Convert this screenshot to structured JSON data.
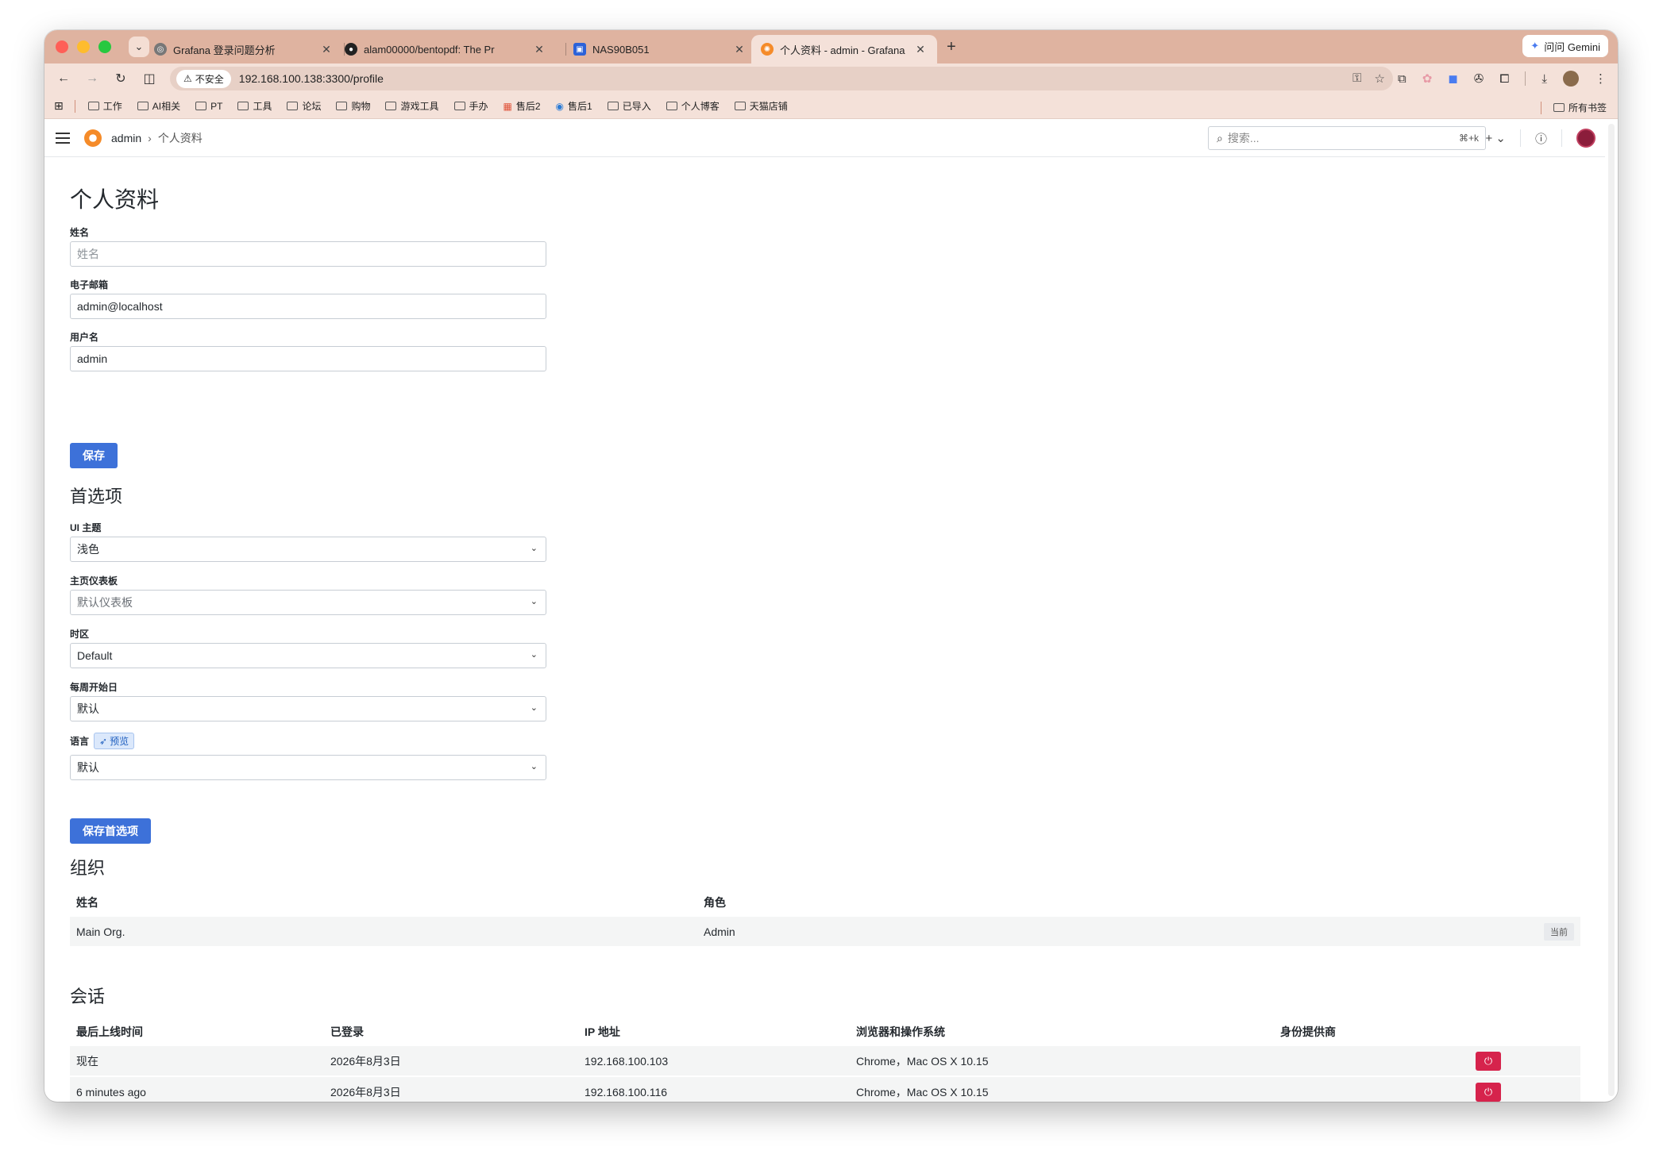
{
  "browser": {
    "tabs": [
      {
        "title": "Grafana 登录问题分析"
      },
      {
        "title": "alam00000/bentopdf: The Pr"
      },
      {
        "title": "NAS90B051"
      },
      {
        "title": "个人资料 - admin - Grafana"
      }
    ],
    "gemini_label": "问问 Gemini",
    "security_label": "不安全",
    "url": "192.168.100.138:3300/profile",
    "bookmarks": [
      "工作",
      "AI相关",
      "PT",
      "工具",
      "论坛",
      "购物",
      "游戏工具",
      "手办",
      "售后2",
      "售后1",
      "已导入",
      "个人博客",
      "天猫店铺"
    ],
    "all_bookmarks": "所有书签"
  },
  "header": {
    "breadcrumb_root": "admin",
    "breadcrumb_current": "个人资料",
    "search_placeholder": "搜索...",
    "search_shortcut": "⌘+k"
  },
  "profile": {
    "title": "个人资料",
    "name_label": "姓名",
    "name_placeholder": "姓名",
    "email_label": "电子邮箱",
    "email_value": "admin@localhost",
    "username_label": "用户名",
    "username_value": "admin",
    "save_label": "保存"
  },
  "preferences": {
    "title": "首选项",
    "theme_label": "UI 主题",
    "theme_value": "浅色",
    "home_label": "主页仪表板",
    "home_value": "默认仪表板",
    "timezone_label": "时区",
    "timezone_value": "Default",
    "week_label": "每周开始日",
    "week_value": "默认",
    "language_label": "语言",
    "preview_badge": "预览",
    "language_value": "默认",
    "save_label": "保存首选项"
  },
  "orgs": {
    "title": "组织",
    "col_name": "姓名",
    "col_role": "角色",
    "rows": [
      {
        "name": "Main Org.",
        "role": "Admin",
        "badge": "当前"
      }
    ]
  },
  "sessions": {
    "title": "会话",
    "col_last_seen": "最后上线时间",
    "col_logged_in": "已登录",
    "col_ip": "IP 地址",
    "col_browser": "浏览器和操作系统",
    "col_provider": "身份提供商",
    "rows": [
      {
        "last_seen": "现在",
        "logged_in": "2026年8月3日",
        "ip": "192.168.100.103",
        "browser": "Chrome，Mac OS X 10.15"
      },
      {
        "last_seen": "6 minutes ago",
        "logged_in": "2026年8月3日",
        "ip": "192.168.100.116",
        "browser": "Chrome，Mac OS X 10.15"
      }
    ]
  }
}
